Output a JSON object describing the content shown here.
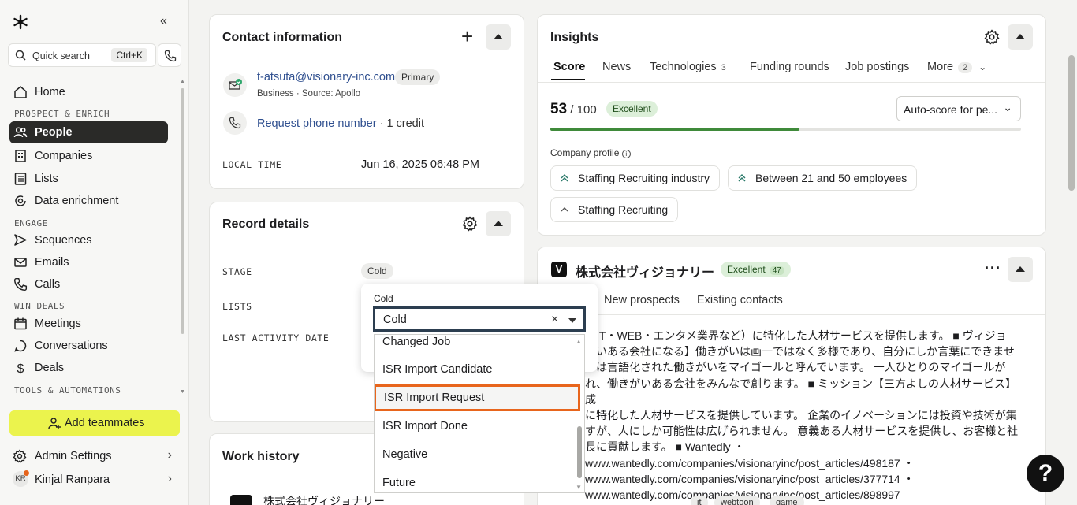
{
  "sidebar": {
    "quick_search": "Quick search",
    "shortcut": "Ctrl+K",
    "home": "Home",
    "section_prospect": "PROSPECT & ENRICH",
    "people": "People",
    "companies": "Companies",
    "lists": "Lists",
    "data_enrichment": "Data enrichment",
    "section_engage": "ENGAGE",
    "sequences": "Sequences",
    "emails": "Emails",
    "calls": "Calls",
    "section_win": "WIN DEALS",
    "meetings": "Meetings",
    "conversations": "Conversations",
    "deals": "Deals",
    "section_tools": "TOOLS & AUTOMATIONS",
    "add_teammates": "Add teammates",
    "admin_settings": "Admin Settings",
    "user_initials": "KR",
    "user_name": "Kinjal Ranpara"
  },
  "contact": {
    "title": "Contact information",
    "email": "t-atsuta@visionary-inc.com",
    "email_badge": "Primary",
    "email_meta": "Business · Source: Apollo",
    "phone_link": "Request phone number",
    "phone_credit": " · 1 credit",
    "local_time_label": "LOCAL TIME",
    "local_time_value": "Jun 16, 2025 06:48 PM"
  },
  "record": {
    "title": "Record details",
    "stage_label": "STAGE",
    "stage_value": "Cold",
    "lists_label": "LISTS",
    "last_activity_label": "LAST ACTIVITY DATE"
  },
  "dropdown": {
    "label": "Cold",
    "value": "Cold",
    "clear": "×",
    "options": [
      "Changed Job",
      "ISR Import Candidate",
      "ISR Import Request",
      "ISR Import Done",
      "Negative",
      "Future"
    ]
  },
  "work_history": {
    "title": "Work history",
    "company": "株式会社ヴィジョナリー"
  },
  "insights": {
    "title": "Insights",
    "tabs": [
      "Score",
      "News",
      "Technologies",
      "Funding rounds",
      "Job postings",
      "More"
    ],
    "technologies_count": "3",
    "more_count": "2",
    "score": "53",
    "score_total": " / 100",
    "score_badge": "Excellent",
    "score_fraction": 0.53,
    "auto_score": "Auto-score for pe...",
    "company_profile": "Company profile",
    "chips": [
      "Staffing Recruiting industry",
      "Between 21 and 50 employees",
      "Staffing Recruiting"
    ]
  },
  "company": {
    "name": "株式会社ヴィジョナリー",
    "badge": "Excellent",
    "badge_count": "47",
    "tab_new": "New prospects",
    "tab_existing": "Existing contacts",
    "description": "（IT・WEB・エンタメ業界など）に特化した人材サービスを提供します。 ■ ヴィジョ\nがいある会社になる】働きがいは画一ではなく多様であり、自分にしか言葉にできませ\nでは言語化された働きがいをマイゴールと呼んでいます。 一人ひとりのマイゴールが\nれ、働きがいある会社をみんなで創ります。 ■ ミッション【三方よしの人材サービス】成\nに特化した人材サービスを提供しています。 企業のイノベーションには投資や技術が集\nすが、人にしか可能性は広げられません。 意義ある人材サービスを提供し、お客様と社\n長に貢献します。 ■ Wantedly ・\nwww.wantedly.com/companies/visionaryinc/post_articles/498187 ・\nwww.wantedly.com/companies/visionaryinc/post_articles/377714 ・\nwww.wantedly.com/companies/visionaryinc/post_articles/898997",
    "tags": [
      "it",
      "webtoon",
      "game"
    ]
  },
  "help": "?"
}
